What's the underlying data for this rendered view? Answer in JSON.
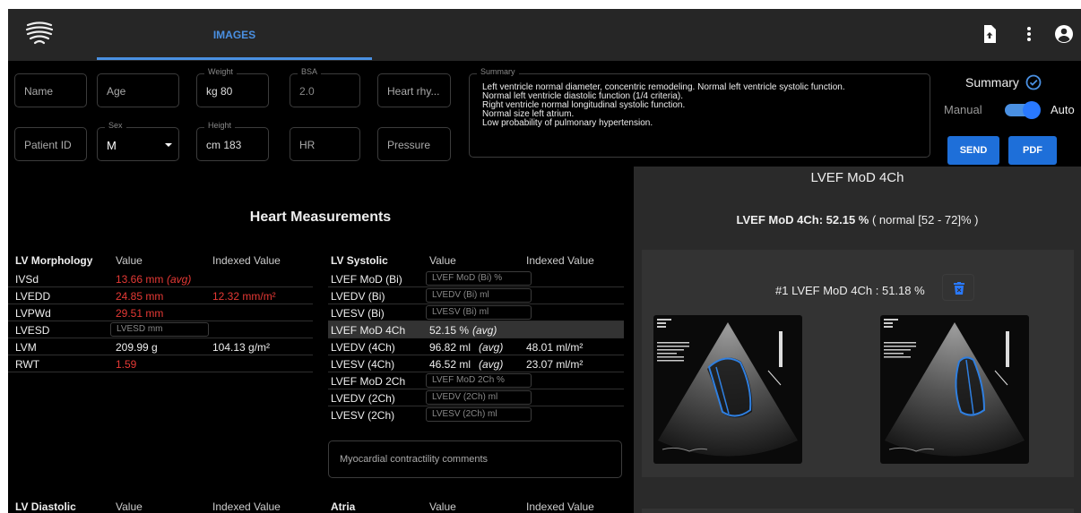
{
  "appbar": {
    "tab_label": "IMAGES",
    "icons": [
      "heart-logo-icon",
      "file-upload-icon",
      "more-vertical-icon",
      "account-icon"
    ]
  },
  "form": {
    "name_placeholder": "Name",
    "age_placeholder": "Age",
    "weight_label": "Weight",
    "weight_value": "kg  80",
    "bsa_label": "BSA",
    "bsa_value": "2.0",
    "heart_rhythm_placeholder": "Heart rhy...",
    "patient_id_placeholder": "Patient ID",
    "sex_label": "Sex",
    "sex_value": "M",
    "height_label": "Height",
    "height_value": "cm  183",
    "hr_placeholder": "HR",
    "pressure_placeholder": "Pressure",
    "summary_label": "Summary",
    "summary_text": "Left ventricle normal diameter, concentric remodeling. Normal left ventricle systolic function.\nNormal left ventricle diastolic function (1/4 criteria).\nRight ventricle normal longitudinal systolic function.\nNormal size left atrium.\nLow probability of pulmonary hypertension."
  },
  "summary_controls": {
    "title": "Summary",
    "manual_label": "Manual",
    "auto_label": "Auto",
    "send_label": "SEND",
    "pdf_label": "PDF"
  },
  "measurements": {
    "title": "Heart Measurements",
    "lv_morphology": {
      "headers": [
        "LV Morphology",
        "Value",
        "Indexed Value"
      ],
      "rows": [
        {
          "name": "IVSd",
          "value": "13.66 mm",
          "avg": "(avg)",
          "indexed": ""
        },
        {
          "name": "LVEDD",
          "value": "24.85 mm",
          "avg": "",
          "indexed": "12.32 mm/m²"
        },
        {
          "name": "LVPWd",
          "value": "29.51 mm",
          "avg": "",
          "indexed": ""
        },
        {
          "name": "LVESD",
          "value": "",
          "avg": "",
          "indexed": "",
          "input": "LVESD mm"
        },
        {
          "name": "LVM",
          "value": "209.99 g",
          "avg": "",
          "indexed": "104.13 g/m²"
        },
        {
          "name": "RWT",
          "value": "1.59",
          "avg": "",
          "indexed": ""
        }
      ]
    },
    "lv_systolic": {
      "headers": [
        "LV Systolic",
        "Value",
        "Indexed Value"
      ],
      "rows": [
        {
          "name": "LVEF MoD (Bi)",
          "value": "",
          "input": "LVEF MoD (Bi) %",
          "indexed": ""
        },
        {
          "name": "LVEDV (Bi)",
          "value": "",
          "input": "LVEDV (Bi) ml",
          "indexed": ""
        },
        {
          "name": "LVESV (Bi)",
          "value": "",
          "input": "LVESV (Bi) ml",
          "indexed": ""
        },
        {
          "name": "LVEF MoD 4Ch",
          "value": "52.15 %",
          "avg": "(avg)",
          "indexed": ""
        },
        {
          "name": "LVEDV (4Ch)",
          "value": "96.82 ml",
          "avg": "(avg)",
          "indexed": "48.01 ml/m²"
        },
        {
          "name": "LVESV (4Ch)",
          "value": "46.52 ml",
          "avg": "(avg)",
          "indexed": "23.07 ml/m²"
        },
        {
          "name": "LVEF MoD 2Ch",
          "value": "",
          "input": "LVEF MoD 2Ch %",
          "indexed": ""
        },
        {
          "name": "LVEDV (2Ch)",
          "value": "",
          "input": "LVEDV (2Ch) ml",
          "indexed": ""
        },
        {
          "name": "LVESV (2Ch)",
          "value": "",
          "input": "LVESV (2Ch) ml",
          "indexed": ""
        }
      ]
    },
    "comments_placeholder": "Myocardial contractility comments",
    "lv_diastolic_headers": [
      "LV Diastolic",
      "Value",
      "Indexed Value"
    ],
    "atria_headers": [
      "Atria",
      "Value",
      "Indexed Value"
    ]
  },
  "panel": {
    "title": "LVEF MoD 4Ch",
    "result_label": "LVEF MoD 4Ch: 52.15 %",
    "result_range": "( normal [52 - 72]% )",
    "card_title": "#1 LVEF MoD 4Ch : 51.18 %",
    "echo_images": [
      "echo-image-diastole",
      "echo-image-systole"
    ]
  },
  "colors": {
    "accent": "#4a90e2",
    "button": "#1e6fd9",
    "abnormal": "#e53935",
    "background": "#000000",
    "panel": "#2a2a2a"
  }
}
